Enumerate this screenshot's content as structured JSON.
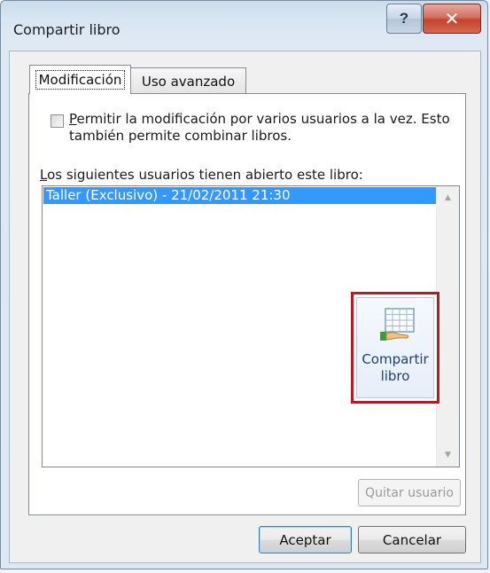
{
  "dialog": {
    "title": "Compartir libro",
    "help_label": "?",
    "close_label": "✕"
  },
  "tabs": [
    {
      "label": "Modificación",
      "active": true
    },
    {
      "label": "Uso avanzado",
      "active": false
    }
  ],
  "allow_multi": {
    "checked": false,
    "label_underlined_char": "P",
    "label_rest": "ermitir la modificación por varios usuarios a la vez. Esto también permite combinar libros."
  },
  "users": {
    "label_underlined_char": "L",
    "label_rest": "os siguientes usuarios tienen abierto este libro:",
    "rows": [
      "Taller (Exclusivo) - 21/02/2011 21:30"
    ]
  },
  "share_button": {
    "line1": "Compartir",
    "line2": "libro",
    "icon": "share-workbook-icon"
  },
  "buttons": {
    "remove_user": "Quitar usuario",
    "ok": "Aceptar",
    "cancel": "Cancelar"
  }
}
